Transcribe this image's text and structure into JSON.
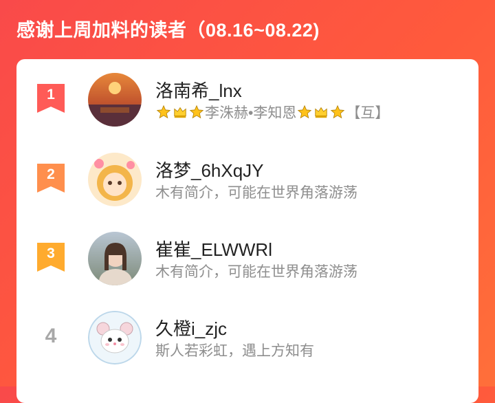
{
  "header": {
    "title": "感谢上周加料的读者（08.16~08.22)"
  },
  "colors": {
    "rank1": "#ff5b57",
    "rank2": "#ff8f4d",
    "rank3": "#ffab2e",
    "rank_plain": "#a8a8a8"
  },
  "readers": [
    {
      "rank": "1",
      "name": "洛南希_lnx",
      "bio": {
        "middle": "李洙赫•李知恩",
        "tail": "【互】",
        "icons": [
          "star-icon",
          "crown-icon",
          "star-icon",
          "star-icon",
          "crown-icon",
          "star-icon"
        ]
      }
    },
    {
      "rank": "2",
      "name": "洛梦_6hXqJY",
      "bio": {
        "text": "木有简介，可能在世界角落游荡"
      }
    },
    {
      "rank": "3",
      "name": "崔崔_ELWWRl",
      "bio": {
        "text": "木有简介，可能在世界角落游荡"
      }
    },
    {
      "rank": "4",
      "name": "久橙i_zjc",
      "bio": {
        "text": "斯人若彩虹，遇上方知有"
      }
    }
  ]
}
